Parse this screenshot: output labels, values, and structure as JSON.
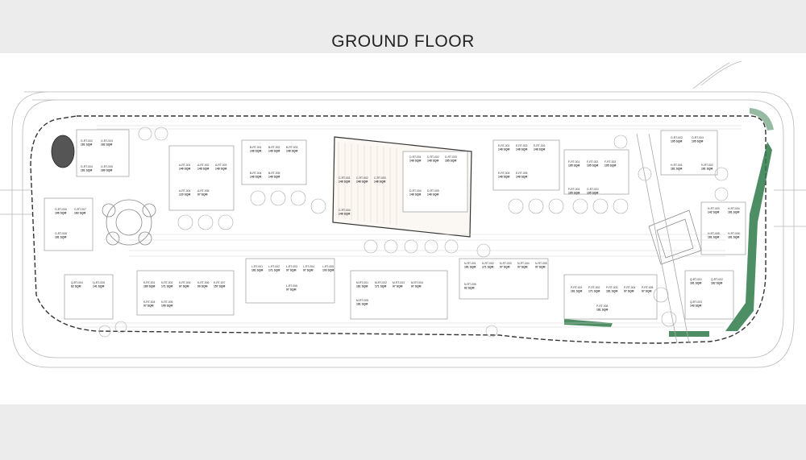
{
  "page": {
    "title": "GROUND FLOOR"
  },
  "colors": {
    "background": "#ececec",
    "sheet": "#ffffff",
    "line": "#9a9a9a",
    "dark_line": "#333333",
    "landscape_green": "#2f7a4a"
  },
  "units": [
    {
      "id": "a",
      "code": "G-RT-002",
      "area": "181 SQM"
    },
    {
      "id": "b",
      "code": "G-RT-003",
      "area": "182 SQM"
    },
    {
      "id": "c",
      "code": "G-RT-004",
      "area": "181 SQM"
    },
    {
      "id": "d",
      "code": "G-RT-005",
      "area": "180 SQM"
    },
    {
      "id": "e",
      "code": "G-RT-006",
      "area": "196 SQM"
    },
    {
      "id": "f",
      "code": "G-RT-007",
      "area": "183 SQM"
    },
    {
      "id": "g",
      "code": "G-RT-008",
      "area": "181 SQM"
    },
    {
      "id": "h",
      "code": "A-RT-001",
      "area": "146 SQM"
    },
    {
      "id": "i",
      "code": "A-RT-002",
      "area": "148 SQM"
    },
    {
      "id": "j",
      "code": "A-RT-003",
      "area": "148 SQM"
    },
    {
      "id": "k",
      "code": "A-RT-004",
      "area": "120 SQM"
    },
    {
      "id": "l",
      "code": "A-RT-005",
      "area": "97 SQM"
    },
    {
      "id": "m",
      "code": "B-RT-001",
      "area": "148 SQM"
    },
    {
      "id": "n",
      "code": "B-RT-002",
      "area": "148 SQM"
    },
    {
      "id": "o",
      "code": "B-RT-003",
      "area": "148 SQM"
    },
    {
      "id": "p",
      "code": "B-RT-004",
      "area": "148 SQM"
    },
    {
      "id": "q",
      "code": "B-RT-005",
      "area": "148 SQM"
    },
    {
      "id": "r",
      "code": "C-RT-001",
      "area": "148 SQM"
    },
    {
      "id": "s",
      "code": "C-RT-002",
      "area": "148 SQM"
    },
    {
      "id": "t",
      "code": "C-RT-003",
      "area": "148 SQM"
    },
    {
      "id": "u",
      "code": "C-RT-004",
      "area": "148 SQM"
    },
    {
      "id": "v",
      "code": "D-RT-001",
      "area": "148 SQM"
    },
    {
      "id": "w",
      "code": "D-RT-002",
      "area": "148 SQM"
    },
    {
      "id": "x",
      "code": "D-RT-003",
      "area": "185 SQM"
    },
    {
      "id": "y",
      "code": "D-RT-004",
      "area": "148 SQM"
    },
    {
      "id": "z",
      "code": "D-RT-005",
      "area": "148 SQM"
    },
    {
      "id": "aa",
      "code": "E-RT-001",
      "area": "148 SQM"
    },
    {
      "id": "ab",
      "code": "E-RT-002",
      "area": "148 SQM"
    },
    {
      "id": "ac",
      "code": "E-RT-003",
      "area": "148 SQM"
    },
    {
      "id": "ad",
      "code": "E-RT-004",
      "area": "148 SQM"
    },
    {
      "id": "ae",
      "code": "E-RT-005",
      "area": "148 SQM"
    },
    {
      "id": "af",
      "code": "F-RT-001",
      "area": "195 SQM"
    },
    {
      "id": "ag",
      "code": "F-RT-002",
      "area": "195 SQM"
    },
    {
      "id": "ah",
      "code": "F-RT-003",
      "area": "195 SQM"
    },
    {
      "id": "ai",
      "code": "F-RT-004",
      "area": "195 SQM"
    },
    {
      "id": "aj",
      "code": "G-RT-001",
      "area": "195 SQM"
    },
    {
      "id": "ak",
      "code": "G-RT-002",
      "area": "195 SQM"
    },
    {
      "id": "al",
      "code": "G-RT-003",
      "area": "195 SQM"
    },
    {
      "id": "am",
      "code": "H-RT-001",
      "area": "181 SQM"
    },
    {
      "id": "an",
      "code": "H-RT-002",
      "area": "181 SQM"
    },
    {
      "id": "ao",
      "code": "H-RT-003",
      "area": "142 SQM"
    },
    {
      "id": "ap",
      "code": "H-RT-004",
      "area": "181 SQM"
    },
    {
      "id": "aq",
      "code": "H-RT-005",
      "area": "181 SQM"
    },
    {
      "id": "ar",
      "code": "H-RT-006",
      "area": "181 SQM"
    },
    {
      "id": "as",
      "code": "K-RT-001",
      "area": "180 SQM"
    },
    {
      "id": "at",
      "code": "K-RT-002",
      "area": "171 SQM"
    },
    {
      "id": "au",
      "code": "K-RT-003",
      "area": "97 SQM"
    },
    {
      "id": "av",
      "code": "K-RT-004",
      "area": "97 SQM"
    },
    {
      "id": "aw",
      "code": "K-RT-005",
      "area": "106 SQM"
    },
    {
      "id": "ax",
      "code": "K-RT-006",
      "area": "99 SQM"
    },
    {
      "id": "ay",
      "code": "K-RT-007",
      "area": "157 SQM"
    },
    {
      "id": "az",
      "code": "L-RT-001",
      "area": "181 SQM"
    },
    {
      "id": "ba",
      "code": "L-RT-002",
      "area": "171 SQM"
    },
    {
      "id": "bb",
      "code": "L-RT-003",
      "area": "97 SQM"
    },
    {
      "id": "bc",
      "code": "L-RT-004",
      "area": "97 SQM"
    },
    {
      "id": "bd",
      "code": "L-RT-005",
      "area": "103 SQM"
    },
    {
      "id": "be",
      "code": "L-RT-006",
      "area": "97 SQM"
    },
    {
      "id": "bf",
      "code": "M-RT-001",
      "area": "181 SQM"
    },
    {
      "id": "bg",
      "code": "M-RT-002",
      "area": "171 SQM"
    },
    {
      "id": "bh",
      "code": "M-RT-003",
      "area": "97 SQM"
    },
    {
      "id": "bi",
      "code": "M-RT-004",
      "area": "97 SQM"
    },
    {
      "id": "bj",
      "code": "M-RT-005",
      "area": "181 SQM"
    },
    {
      "id": "bk",
      "code": "N-RT-001",
      "area": "181 SQM"
    },
    {
      "id": "bl",
      "code": "N-RT-002",
      "area": "171 SQM"
    },
    {
      "id": "bm",
      "code": "N-RT-003",
      "area": "97 SQM"
    },
    {
      "id": "bn",
      "code": "N-RT-004",
      "area": "97 SQM"
    },
    {
      "id": "bo",
      "code": "N-RT-005",
      "area": "97 SQM"
    },
    {
      "id": "bp",
      "code": "N-RT-006",
      "area": "82 SQM"
    },
    {
      "id": "bq",
      "code": "P-RT-001",
      "area": "181 SQM"
    },
    {
      "id": "br",
      "code": "P-RT-002",
      "area": "171 SQM"
    },
    {
      "id": "bs",
      "code": "P-RT-003",
      "area": "181 SQM"
    },
    {
      "id": "bt",
      "code": "P-RT-004",
      "area": "97 SQM"
    },
    {
      "id": "bu",
      "code": "P-RT-005",
      "area": "97 SQM"
    },
    {
      "id": "bv",
      "code": "P-RT-006",
      "area": "181 SQM"
    },
    {
      "id": "bw",
      "code": "Q-RT-001",
      "area": "181 SQM"
    },
    {
      "id": "bx",
      "code": "Q-RT-002",
      "area": "182 SQM"
    },
    {
      "id": "by",
      "code": "Q-RT-003",
      "area": "143 SQM"
    },
    {
      "id": "bz",
      "code": "Q-RT-004",
      "area": "82 SQM"
    },
    {
      "id": "ca",
      "code": "Q-RT-005",
      "area": "141 SQM"
    }
  ]
}
